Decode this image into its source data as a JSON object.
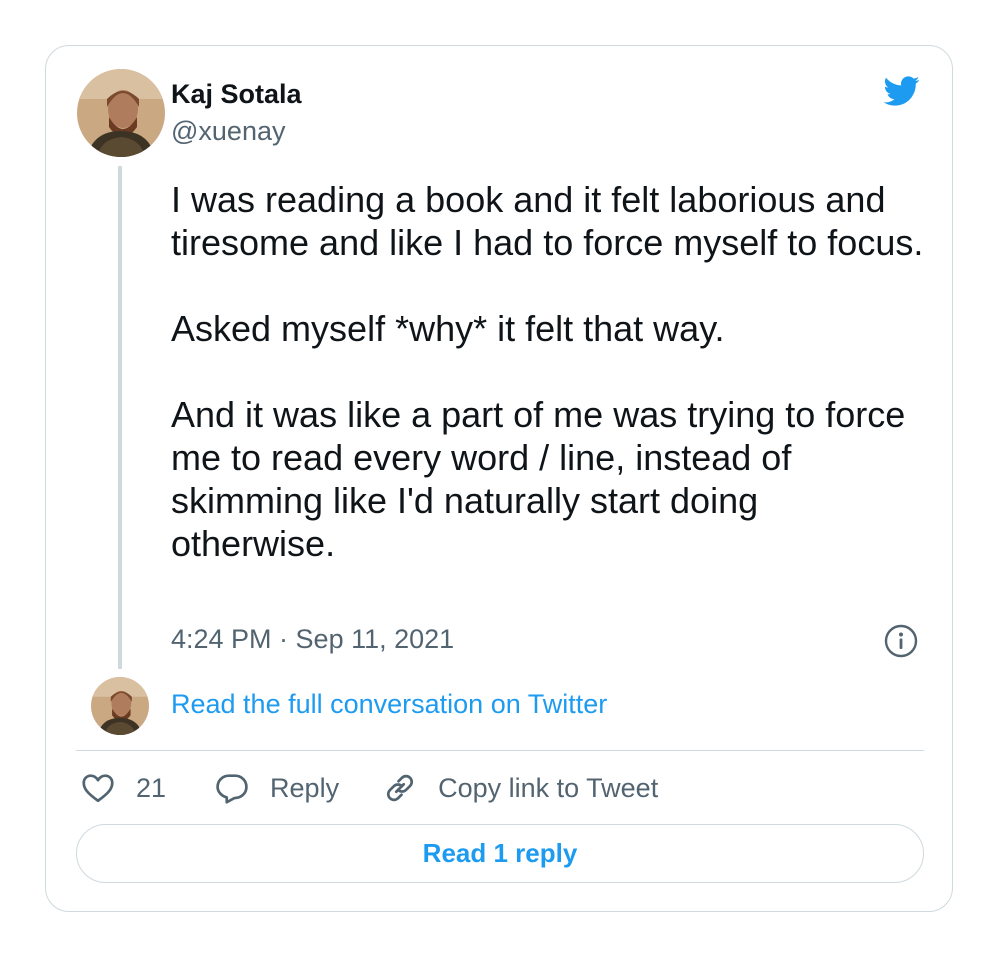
{
  "tweet": {
    "author": {
      "name": "Kaj Sotala",
      "handle": "@xuenay"
    },
    "paragraphs": [
      "I was reading a book and it felt laborious and tiresome and like I had to force myself to focus.",
      "Asked myself *why* it felt that way.",
      "And it was like a part of me was trying to force me to read every word / line, instead of skimming like I'd naturally start doing otherwise."
    ],
    "timestamp": "4:24 PM · Sep 11, 2021",
    "read_conversation_label": "Read the full conversation on Twitter",
    "actions": {
      "like_count": "21",
      "reply_label": "Reply",
      "copy_link_label": "Copy link to Tweet"
    },
    "read_replies_label": "Read 1 reply"
  },
  "colors": {
    "accent": "#1d9bf0",
    "text_primary": "#0f1419",
    "text_secondary": "#536471",
    "border": "#cfd9de"
  },
  "icons": {
    "brand": "twitter-bird-icon",
    "info": "info-icon",
    "like": "heart-icon",
    "reply": "speech-bubble-icon",
    "copy": "link-icon"
  }
}
